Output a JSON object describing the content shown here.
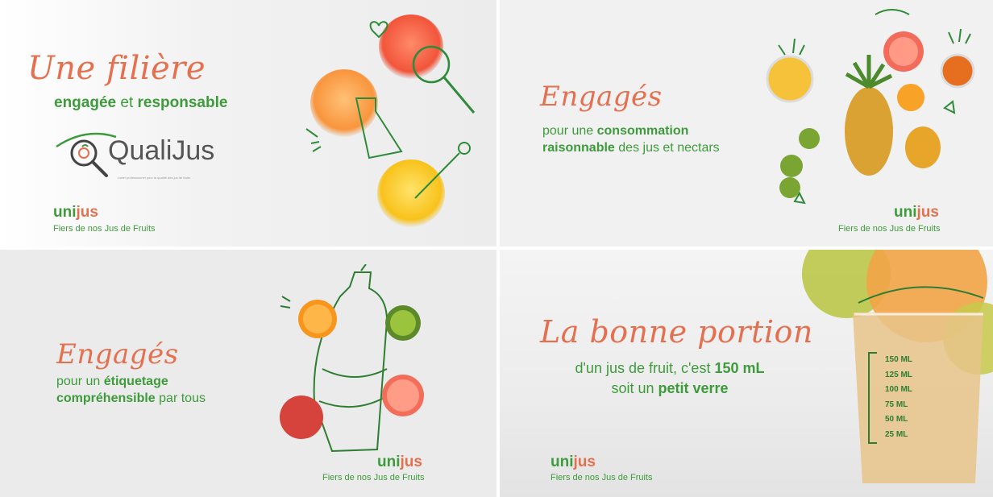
{
  "brand": {
    "name_part1": "uni",
    "name_part2": "jus",
    "tagline": "Fiers de nos Jus de Fruits",
    "green": "#3e9b3b",
    "orange": "#e5704f"
  },
  "panel1": {
    "heading": "Une filière",
    "line_a": "engagée",
    "line_b": "et",
    "line_c": "responsable",
    "logo_q": "Quali",
    "logo_j": "Jus",
    "logo_fine": "Label professionnel pour la qualité des jus de fruits"
  },
  "panel2": {
    "heading": "Engagés",
    "line1_plain": "pour une",
    "line1_bold": "consommation",
    "line2_bold": "raisonnable",
    "line2_plain": "des jus et nectars"
  },
  "panel3": {
    "heading": "Engagés",
    "line1_plain": "pour un",
    "line1_bold": "étiquetage",
    "line2_bold": "compréhensible",
    "line2_plain": "par tous"
  },
  "panel4": {
    "heading": "La bonne portion",
    "line1_plain": "d'un jus de fruit, c'est",
    "line1_bold": "150 mL",
    "line2_plain": "soit un",
    "line2_bold": "petit verre",
    "glass_marks": [
      "150 ML",
      "125 ML",
      "100 ML",
      "75 ML",
      "50 ML",
      "25 ML"
    ]
  }
}
